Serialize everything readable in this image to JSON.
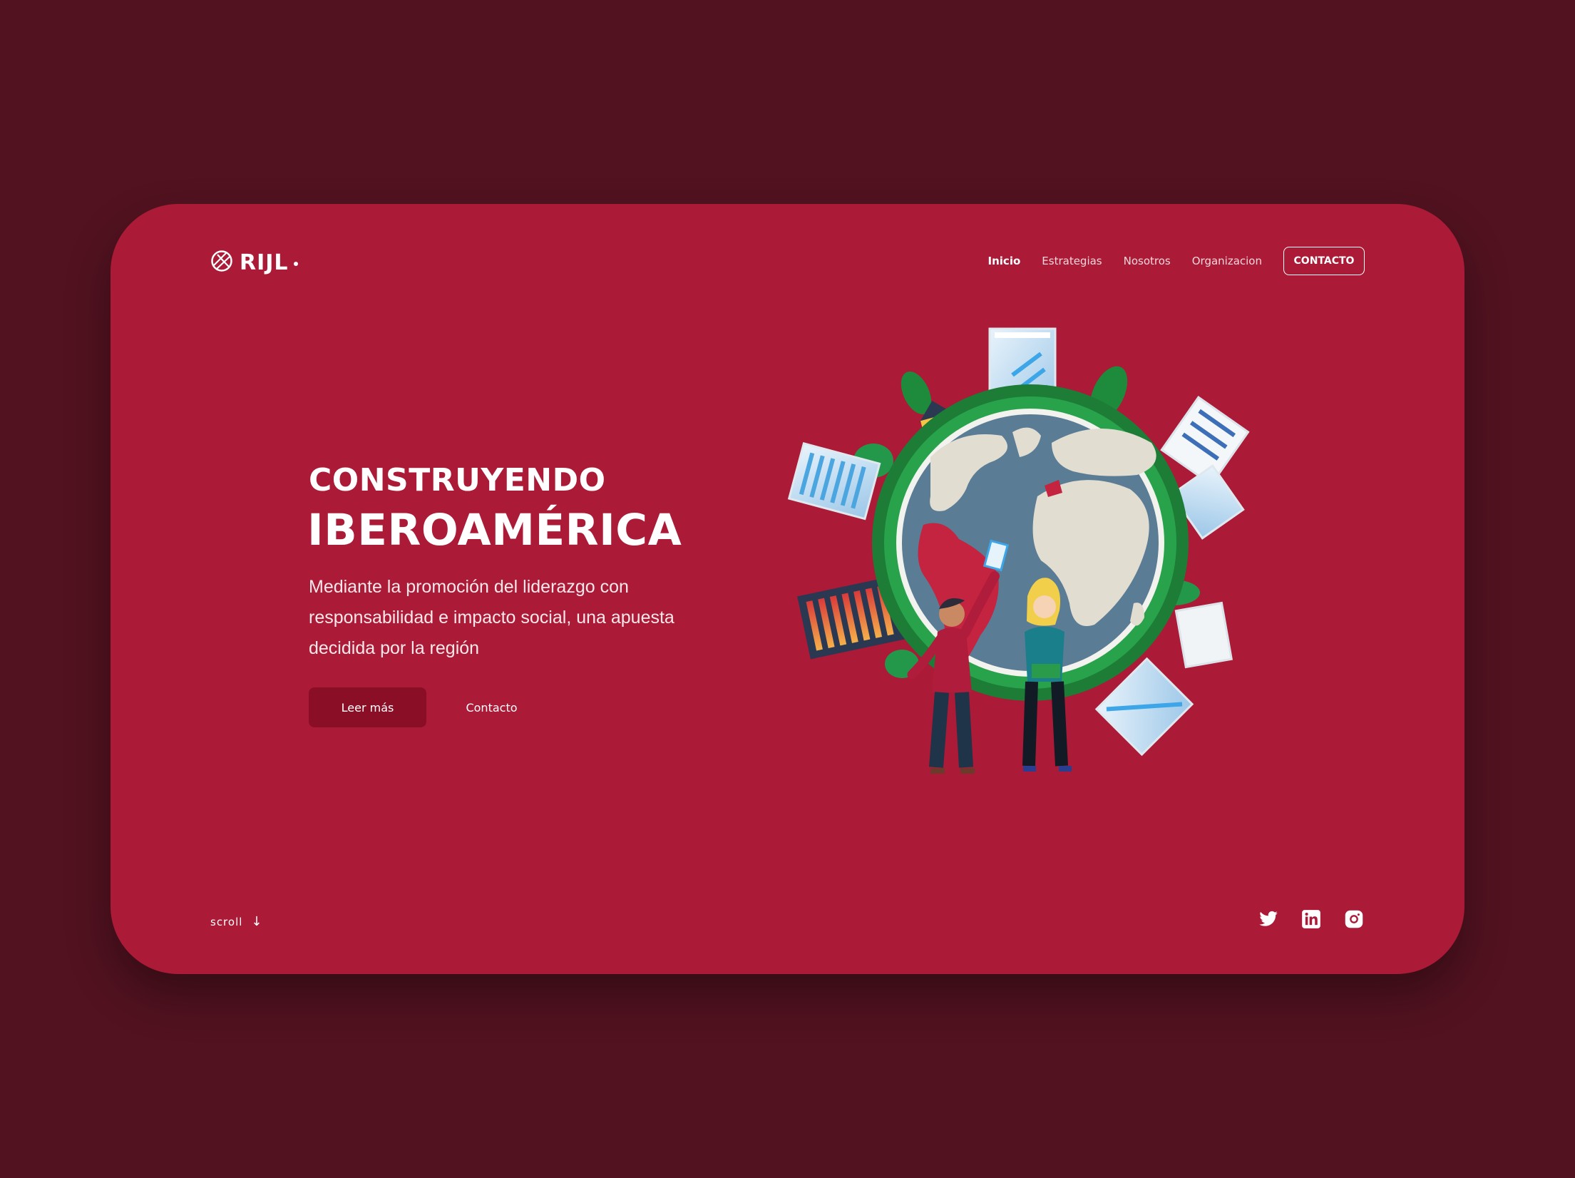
{
  "brand": {
    "name": "RIJL",
    "icon": "globe-icon"
  },
  "nav": {
    "items": [
      {
        "label": "Inicio",
        "active": true
      },
      {
        "label": "Estrategias",
        "active": false
      },
      {
        "label": "Nosotros",
        "active": false
      },
      {
        "label": "Organizacion",
        "active": false
      }
    ],
    "cta_label": "CONTACTO"
  },
  "hero": {
    "title_line1": "CONSTRUYENDO",
    "title_line2": "IBEROAMÉRICA",
    "description": "Mediante la promoción del liderazgo con responsabilidad e impacto social, una apuesta decidida por la región",
    "primary_button": "Leer más",
    "secondary_button": "Contacto",
    "illustration": "globe-with-cities-and-people-illustration"
  },
  "footer": {
    "scroll_label": "scroll",
    "scroll_icon": "arrow-down-icon",
    "socials": [
      "twitter-icon",
      "linkedin-icon",
      "instagram-icon"
    ]
  },
  "colors": {
    "background": "#521220",
    "card": "#ab1a37",
    "primary_button": "#8a0f26",
    "text": "#ffffff"
  }
}
